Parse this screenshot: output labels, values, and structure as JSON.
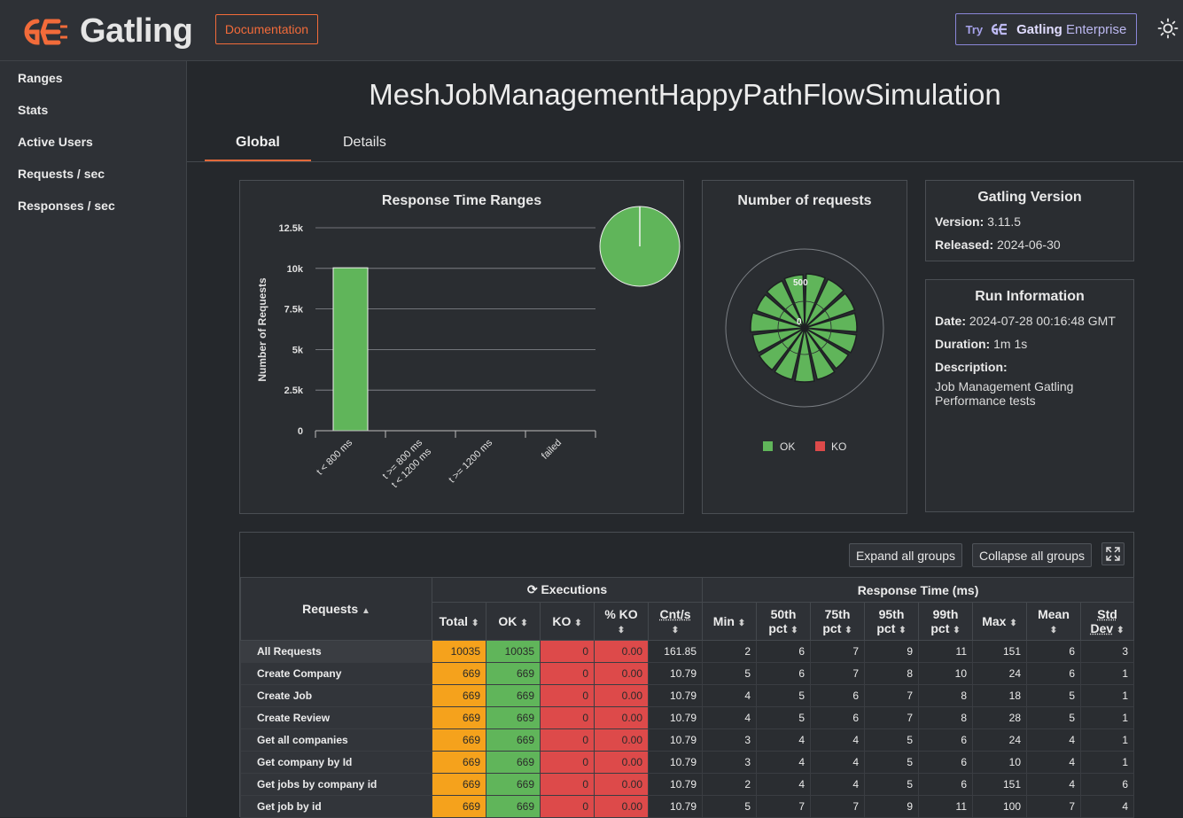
{
  "header": {
    "logo_text": "Gatling",
    "doc_label": "Documentation",
    "try_label": "Try",
    "enterprise_a": "Gatling",
    "enterprise_b": "Enterprise"
  },
  "sidebar": {
    "items": [
      {
        "label": "Ranges"
      },
      {
        "label": "Stats"
      },
      {
        "label": "Active Users"
      },
      {
        "label": "Requests / sec"
      },
      {
        "label": "Responses / sec"
      }
    ]
  },
  "main": {
    "title": "MeshJobManagementHappyPathFlowSimulation",
    "tabs": [
      {
        "label": "Global"
      },
      {
        "label": "Details"
      }
    ]
  },
  "ranges_panel": {
    "title": "Response Time Ranges",
    "ylabel": "Number of Requests",
    "yticks": [
      "12.5k",
      "10k",
      "7.5k",
      "5k",
      "2.5k",
      "0"
    ],
    "xticks": [
      "t < 800 ms",
      "t >= 800 ms",
      "t < 1200 ms",
      "t >= 1200 ms",
      "failed"
    ]
  },
  "requests_panel": {
    "title": "Number of requests",
    "label_500": "500",
    "label_0": "0",
    "legend_ok": "OK",
    "legend_ko": "KO"
  },
  "version_panel": {
    "title": "Gatling Version",
    "version_label": "Version:",
    "version_value": "3.11.5",
    "released_label": "Released:",
    "released_value": "2024-06-30"
  },
  "run_panel": {
    "title": "Run Information",
    "date_label": "Date:",
    "date_value": "2024-07-28 00:16:48 GMT",
    "duration_label": "Duration:",
    "duration_value": "1m 1s",
    "description_label": "Description:",
    "description_value": "Job Management Gatling Performance tests"
  },
  "chart_data": [
    {
      "type": "bar",
      "title": "Response Time Ranges",
      "ylabel": "Number of Requests",
      "categories": [
        "t < 800 ms",
        "t >= 800 ms t < 1200 ms",
        "t >= 1200 ms",
        "failed"
      ],
      "values": [
        10035,
        0,
        0,
        0
      ],
      "ylim": [
        0,
        12500
      ]
    },
    {
      "type": "pie",
      "categories": [
        "t < 800 ms",
        "t >= 800 ms t < 1200 ms",
        "t >= 1200 ms",
        "failed"
      ],
      "values": [
        10035,
        0,
        0,
        0
      ]
    }
  ],
  "table": {
    "expand_label": "Expand all groups",
    "collapse_label": "Collapse all groups",
    "headers": {
      "requests": "Requests",
      "executions": "Executions",
      "response_time": "Response Time (ms)",
      "total": "Total",
      "ok": "OK",
      "ko": "KO",
      "pko": "% KO",
      "cnts": "Cnt/s",
      "min": "Min",
      "p50a": "50th",
      "p75a": "75th",
      "p95a": "95th",
      "p99a": "99th",
      "pct": "pct",
      "max": "Max",
      "mean": "Mean",
      "std_a": "Std",
      "std_b": "Dev"
    },
    "rows": [
      {
        "name": "All Requests",
        "total": "10035",
        "ok": "10035",
        "ko": "0",
        "pko": "0.00",
        "cnts": "161.85",
        "min": "2",
        "p50": "6",
        "p75": "7",
        "p95": "9",
        "p99": "11",
        "max": "151",
        "mean": "6",
        "std": "3"
      },
      {
        "name": "Create Company",
        "total": "669",
        "ok": "669",
        "ko": "0",
        "pko": "0.00",
        "cnts": "10.79",
        "min": "5",
        "p50": "6",
        "p75": "7",
        "p95": "8",
        "p99": "10",
        "max": "24",
        "mean": "6",
        "std": "1"
      },
      {
        "name": "Create Job",
        "total": "669",
        "ok": "669",
        "ko": "0",
        "pko": "0.00",
        "cnts": "10.79",
        "min": "4",
        "p50": "5",
        "p75": "6",
        "p95": "7",
        "p99": "8",
        "max": "18",
        "mean": "5",
        "std": "1"
      },
      {
        "name": "Create Review",
        "total": "669",
        "ok": "669",
        "ko": "0",
        "pko": "0.00",
        "cnts": "10.79",
        "min": "4",
        "p50": "5",
        "p75": "6",
        "p95": "7",
        "p99": "8",
        "max": "28",
        "mean": "5",
        "std": "1"
      },
      {
        "name": "Get all companies",
        "total": "669",
        "ok": "669",
        "ko": "0",
        "pko": "0.00",
        "cnts": "10.79",
        "min": "3",
        "p50": "4",
        "p75": "4",
        "p95": "5",
        "p99": "6",
        "max": "24",
        "mean": "4",
        "std": "1"
      },
      {
        "name": "Get company by Id",
        "total": "669",
        "ok": "669",
        "ko": "0",
        "pko": "0.00",
        "cnts": "10.79",
        "min": "3",
        "p50": "4",
        "p75": "4",
        "p95": "5",
        "p99": "6",
        "max": "10",
        "mean": "4",
        "std": "1"
      },
      {
        "name": "Get jobs by company id",
        "total": "669",
        "ok": "669",
        "ko": "0",
        "pko": "0.00",
        "cnts": "10.79",
        "min": "2",
        "p50": "4",
        "p75": "4",
        "p95": "5",
        "p99": "6",
        "max": "151",
        "mean": "4",
        "std": "6"
      },
      {
        "name": "Get job by id",
        "total": "669",
        "ok": "669",
        "ko": "0",
        "pko": "0.00",
        "cnts": "10.79",
        "min": "5",
        "p50": "7",
        "p75": "7",
        "p95": "9",
        "p99": "11",
        "max": "100",
        "mean": "7",
        "std": "4"
      }
    ]
  },
  "colors": {
    "accent": "#e2693a",
    "ok": "#60b55a",
    "ko": "#dd4a4a",
    "total": "#f5a21c"
  }
}
